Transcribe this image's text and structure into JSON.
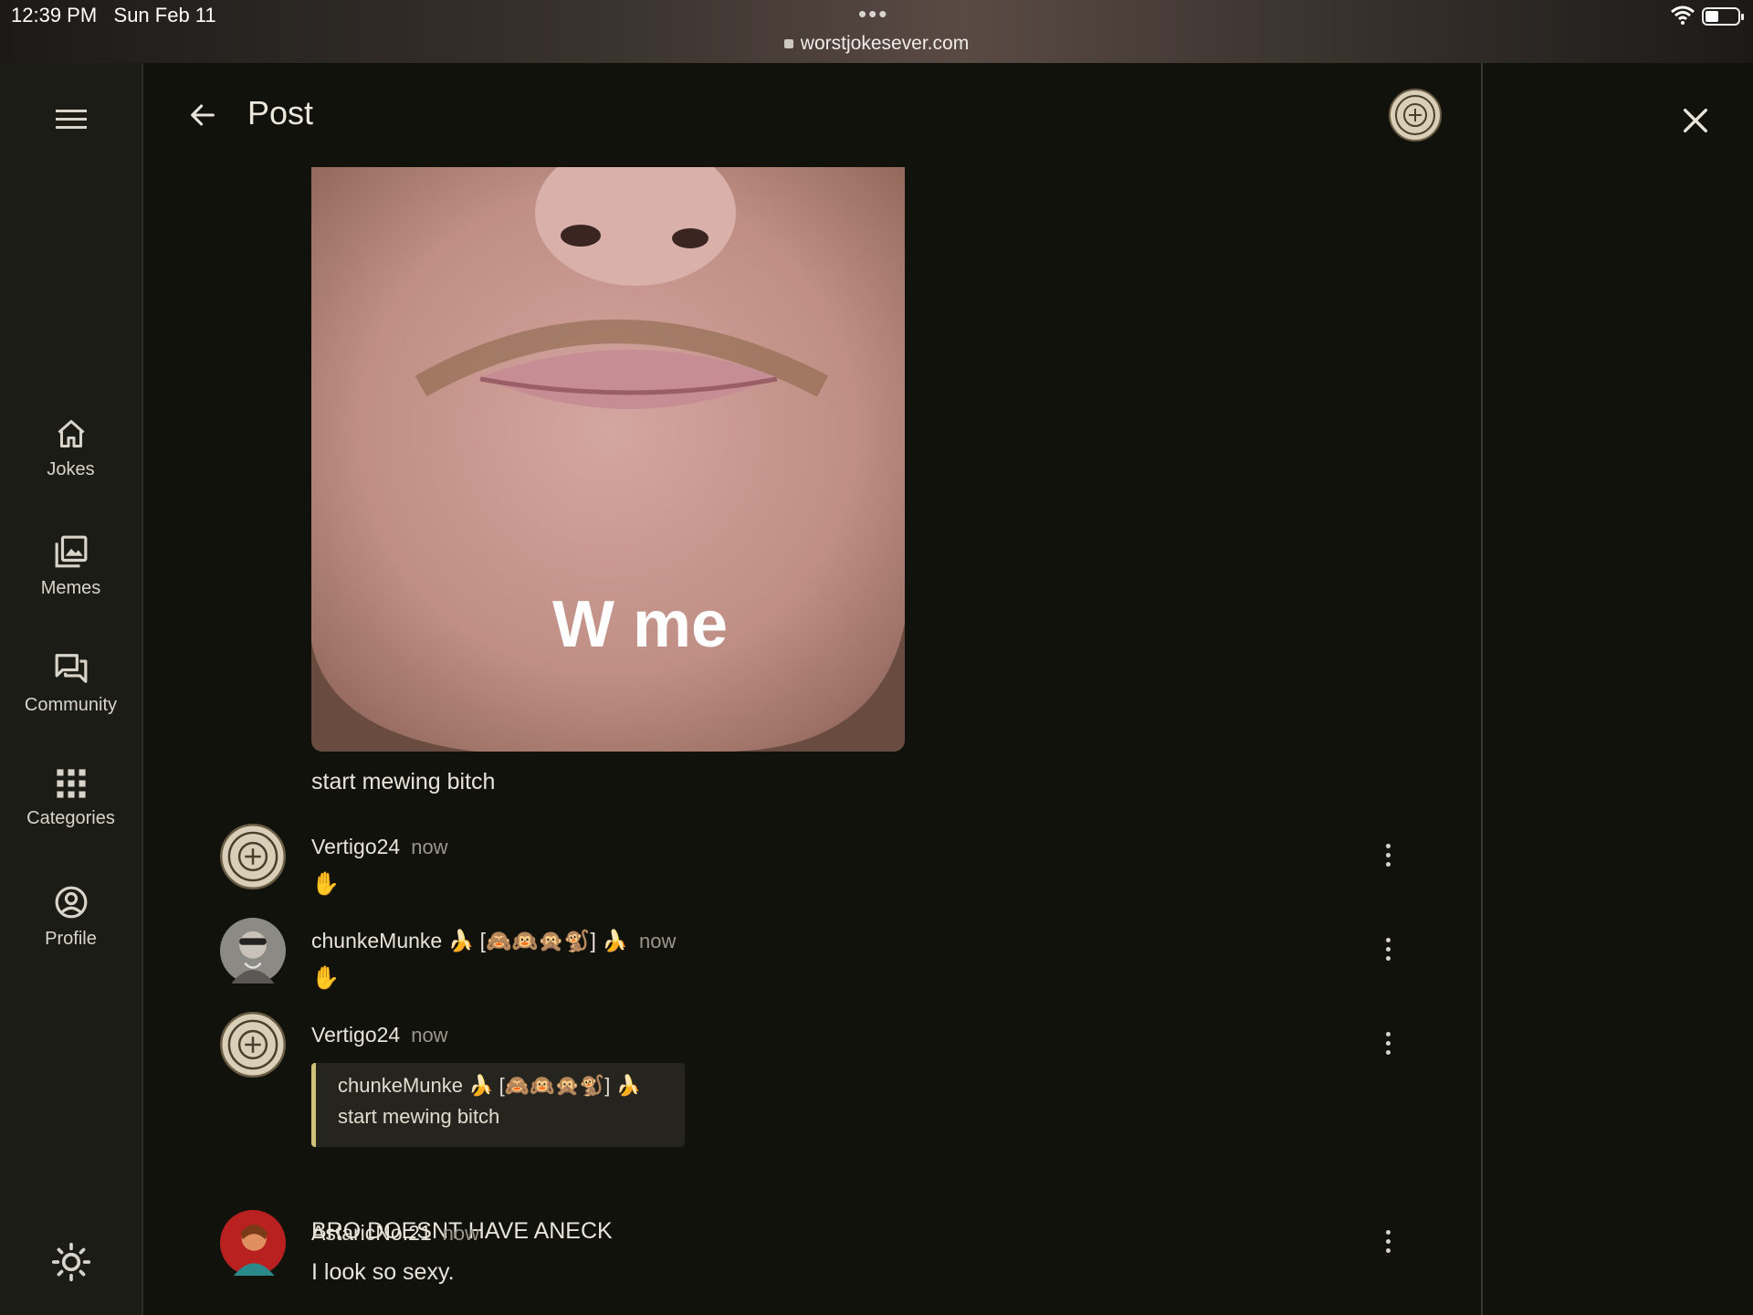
{
  "status_bar": {
    "time": "12:39 PM",
    "date": "Sun Feb 11",
    "dots": "•••",
    "url": "worstjokesever.com"
  },
  "rail": {
    "items": [
      {
        "label": "Jokes",
        "icon": "home-icon"
      },
      {
        "label": "Memes",
        "icon": "images-icon"
      },
      {
        "label": "Community",
        "icon": "chat-icon"
      },
      {
        "label": "Categories",
        "icon": "grid-icon"
      },
      {
        "label": "Profile",
        "icon": "user-circle-icon"
      }
    ]
  },
  "header": {
    "title": "Post"
  },
  "post": {
    "image_text": "W me",
    "caption": "start mewing bitch"
  },
  "comments": [
    {
      "author": "Vertigo24",
      "time": "now",
      "text": "✋"
    },
    {
      "author": "chunkeMunke 🍌 [🙈🙉🙊🐒] 🍌",
      "time": "now",
      "text": "✋"
    },
    {
      "author": "Vertigo24",
      "time": "now",
      "quote_author": "chunkeMunke 🍌 [🙈🙉🙊🐒] 🍌",
      "quote_text": "start mewing bitch",
      "text": "BRO DOESNT HAVE ANECK"
    },
    {
      "author": "AstaricNo.21",
      "time": "now",
      "text": "I look so sexy."
    }
  ],
  "colors": {
    "background": "#12120d",
    "rail": "#1c1c17",
    "quote_accent": "#cfc07a",
    "muted_text": "#9a968c"
  }
}
